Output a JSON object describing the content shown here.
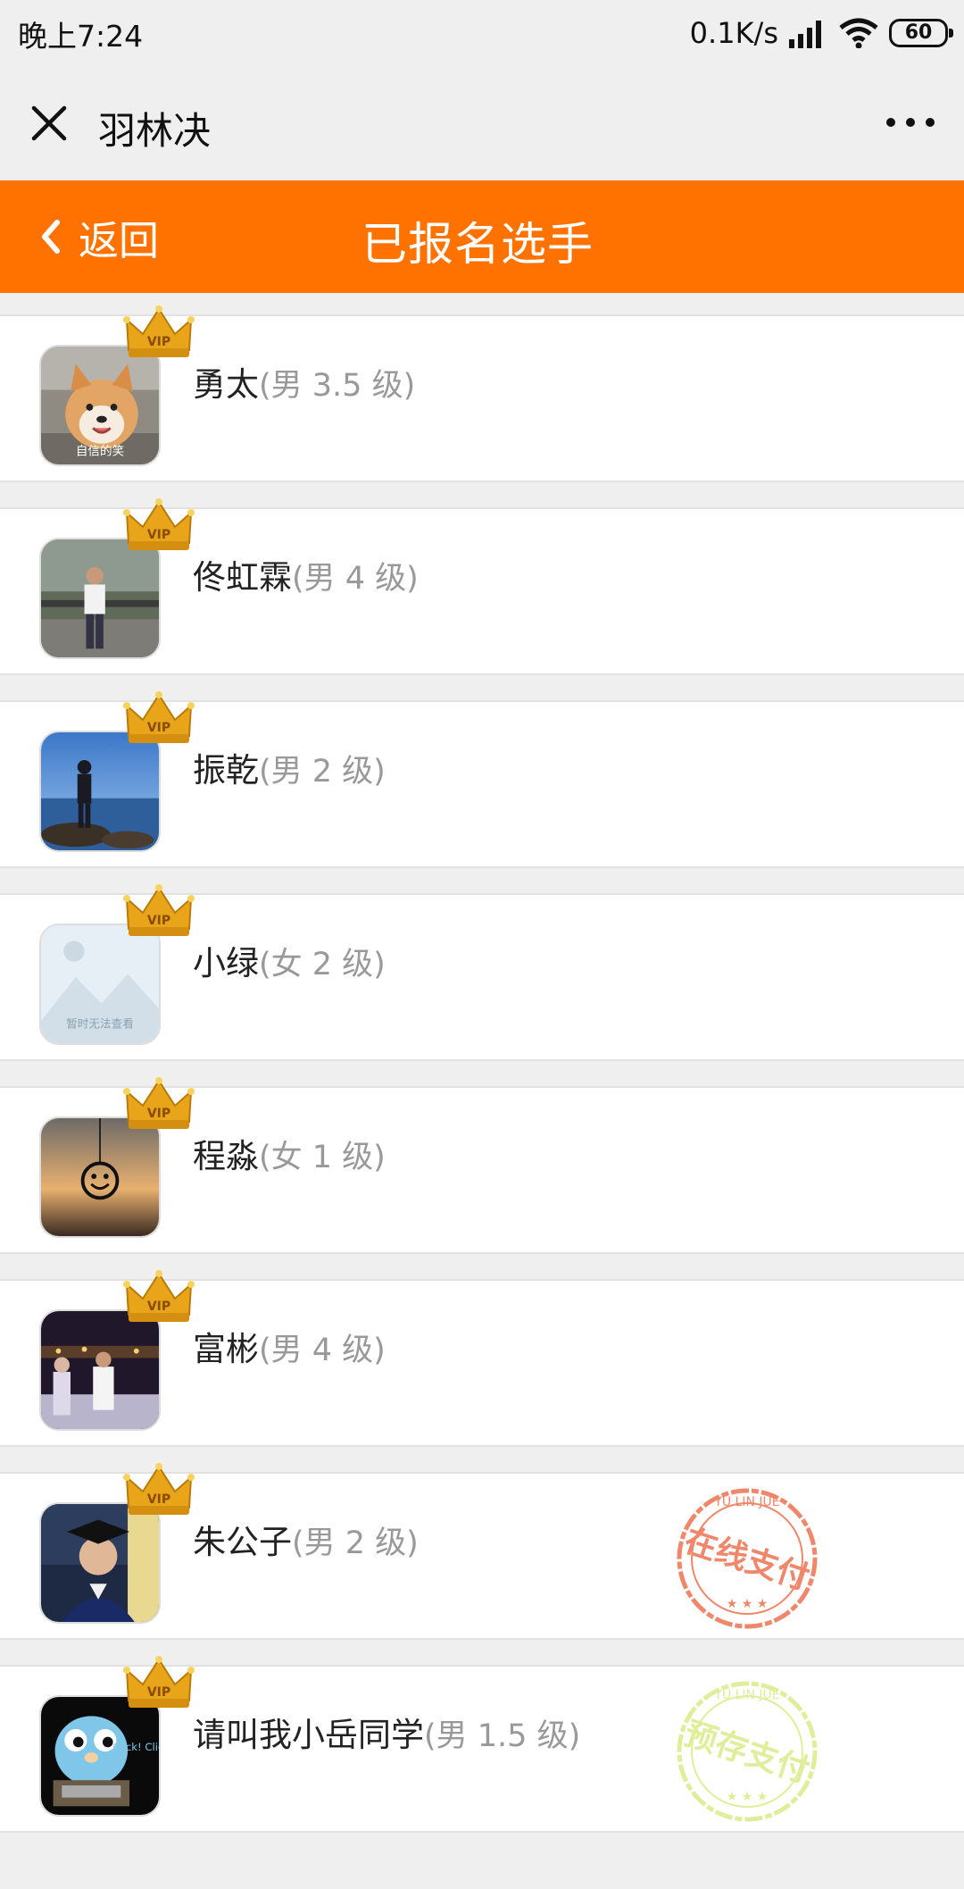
{
  "status_bar": {
    "time": "晚上7:24",
    "network_speed": "0.1K/s",
    "battery": "60"
  },
  "mini_program": {
    "title": "羽林决"
  },
  "header": {
    "back_label": "返回",
    "title": "已报名选手",
    "color": "#ff7200"
  },
  "players": [
    {
      "name": "勇太",
      "meta": "(男 3.5 级)",
      "avatar": "shiba-dog-photo",
      "avatar_caption": "自信的笑",
      "badge": "VIP",
      "stamp": null
    },
    {
      "name": "佟虹霖",
      "meta": "(男 4 级)",
      "avatar": "man-by-railing-photo",
      "badge": "VIP",
      "stamp": null
    },
    {
      "name": "振乾",
      "meta": "(男 2 级)",
      "avatar": "lakeside-silhouette-photo",
      "badge": "VIP",
      "stamp": null
    },
    {
      "name": "小绿",
      "meta": "(女 2 级)",
      "avatar": "placeholder-image",
      "avatar_caption": "暂时无法查看",
      "badge": "VIP",
      "stamp": null
    },
    {
      "name": "程淼",
      "meta": "(女 1 级)",
      "avatar": "smiley-pendant-sunset-photo",
      "badge": "VIP",
      "stamp": null
    },
    {
      "name": "富彬",
      "meta": "(男 4 级)",
      "avatar": "night-group-photo",
      "badge": "VIP",
      "stamp": null
    },
    {
      "name": "朱公子",
      "meta": "(男 2 级)",
      "avatar": "graduation-portrait-photo",
      "badge": "VIP",
      "stamp": {
        "text": "在线支付",
        "arc_text": "YU LIN JUE",
        "color": "#f0866a"
      }
    },
    {
      "name": "请叫我小岳同学",
      "meta": "(男 1.5 级)",
      "avatar": "gopher-cartoon",
      "avatar_caption": "Click! Click!",
      "badge": "VIP",
      "stamp": {
        "text": "预存支付",
        "arc_text": "YU LIN JUE",
        "color": "#dfee9a"
      }
    }
  ]
}
